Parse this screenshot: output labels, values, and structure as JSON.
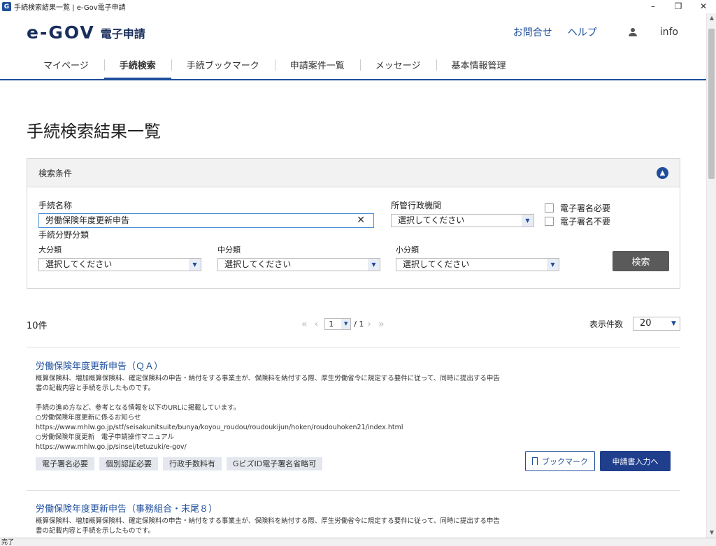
{
  "window": {
    "title": "手続検索結果一覧 | e-Gov電子申請",
    "app_icon": "G",
    "minimize": "–",
    "restore": "❐",
    "close": "✕"
  },
  "header": {
    "logo_mark": "e-GOV",
    "logo_sub": "電子申請",
    "contact": "お問合せ",
    "help": "ヘルプ",
    "user": "info"
  },
  "nav": {
    "tabs": [
      {
        "label": "マイページ",
        "active": false
      },
      {
        "label": "手続検索",
        "active": true
      },
      {
        "label": "手続ブックマーク",
        "active": false
      },
      {
        "label": "申請案件一覧",
        "active": false
      },
      {
        "label": "メッセージ",
        "active": false
      },
      {
        "label": "基本情報管理",
        "active": false
      }
    ]
  },
  "page": {
    "title": "手続検索結果一覧"
  },
  "search": {
    "panel_title": "検索条件",
    "name_label": "手続名称",
    "name_value": "労働保険年度更新申告",
    "agency_label": "所管行政機関",
    "agency_value": "選択してください",
    "sig_required": "電子署名必要",
    "sig_not_required": "電子署名不要",
    "category_label": "手続分野分類",
    "large_label": "大分類",
    "large_value": "選択してください",
    "medium_label": "中分類",
    "medium_value": "選択してください",
    "small_label": "小分類",
    "small_value": "選択してください",
    "search_button": "検索"
  },
  "results": {
    "count": "10件",
    "page_current": "1",
    "page_total": "/ 1",
    "per_page_label": "表示件数",
    "per_page_value": "20",
    "items": [
      {
        "title": "労働保険年度更新申告（ＱＡ）",
        "desc": [
          "概算保険料、増加概算保険料、確定保険料の申告・納付をする事業主が、保険料を納付する際、厚生労働省令に規定する要件に従って、同時に提出する申告",
          "書の記載内容と手続を示したものです。",
          "",
          "手続の進め方など、参考となる情報を以下のURLに掲載しています。",
          "○労働保険年度更新に係るお知らせ",
          "https://www.mhlw.go.jp/stf/seisakunitsuite/bunya/koyou_roudou/roudoukijun/hoken/roudouhoken21/index.html",
          "○労働保険年度更新　電子申請操作マニュアル",
          "https://www.mhlw.go.jp/sinsei/tetuzuki/e-gov/"
        ],
        "tags": [
          "電子署名必要",
          "個別認証必要",
          "行政手数料有",
          "GビズID電子署名省略可"
        ],
        "bookmark": "ブックマーク",
        "apply": "申請書入力へ"
      },
      {
        "title": "労働保険年度更新申告（事務組合・末尾８）",
        "desc": [
          "概算保険料、増加概算保険料、確定保険料の申告・納付をする事業主が、保険料を納付する際、厚生労働省令に規定する要件に従って、同時に提出する申告",
          "書の記載内容と手続を示したものです。"
        ]
      }
    ]
  },
  "statusbar": {
    "text": "完了"
  },
  "colors": {
    "brand": "#1f4f9c",
    "button_dark": "#1f3f8c",
    "search_button": "#5a5a5a"
  }
}
